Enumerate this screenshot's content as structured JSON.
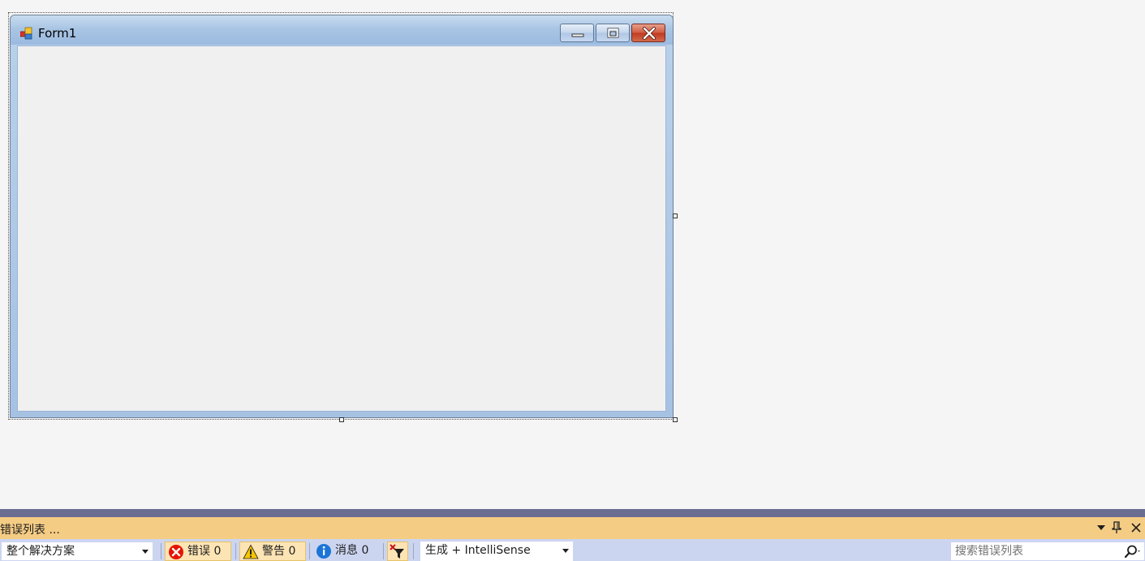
{
  "form": {
    "title": "Form1",
    "icon": "winform-app-icon"
  },
  "error_list": {
    "title": "错误列表 ...",
    "scope_selected": "整个解决方案",
    "errors_label": "错误 0",
    "warnings_label": "警告 0",
    "messages_label": "消息 0",
    "build_filter_selected": "生成 + IntelliSense",
    "search_placeholder": "搜索错误列表"
  },
  "colors": {
    "panel_title_bg": "#f5cc84",
    "toolbar_bg": "#ccd5f0",
    "error_red": "#e51400",
    "warning_yellow": "#f7c600",
    "info_blue": "#1c75d6"
  }
}
